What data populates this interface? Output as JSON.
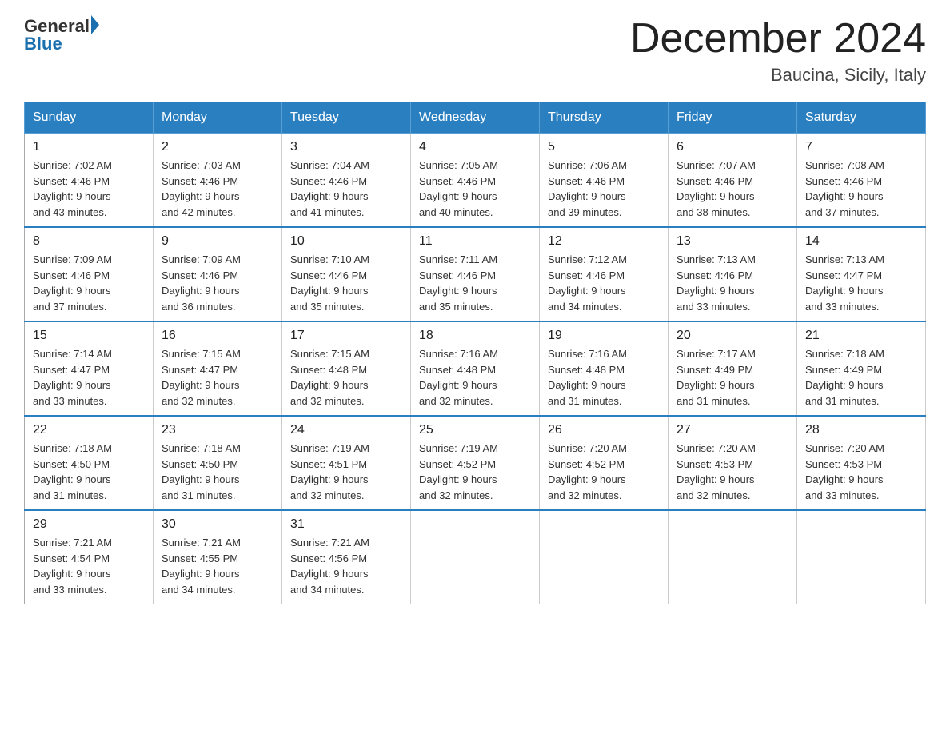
{
  "header": {
    "logo": {
      "general": "General",
      "arrow": "▶",
      "blue": "Blue"
    },
    "title": "December 2024",
    "location": "Baucina, Sicily, Italy"
  },
  "days_of_week": [
    "Sunday",
    "Monday",
    "Tuesday",
    "Wednesday",
    "Thursday",
    "Friday",
    "Saturday"
  ],
  "weeks": [
    [
      {
        "day": "1",
        "sunrise": "7:02 AM",
        "sunset": "4:46 PM",
        "daylight": "9 hours and 43 minutes."
      },
      {
        "day": "2",
        "sunrise": "7:03 AM",
        "sunset": "4:46 PM",
        "daylight": "9 hours and 42 minutes."
      },
      {
        "day": "3",
        "sunrise": "7:04 AM",
        "sunset": "4:46 PM",
        "daylight": "9 hours and 41 minutes."
      },
      {
        "day": "4",
        "sunrise": "7:05 AM",
        "sunset": "4:46 PM",
        "daylight": "9 hours and 40 minutes."
      },
      {
        "day": "5",
        "sunrise": "7:06 AM",
        "sunset": "4:46 PM",
        "daylight": "9 hours and 39 minutes."
      },
      {
        "day": "6",
        "sunrise": "7:07 AM",
        "sunset": "4:46 PM",
        "daylight": "9 hours and 38 minutes."
      },
      {
        "day": "7",
        "sunrise": "7:08 AM",
        "sunset": "4:46 PM",
        "daylight": "9 hours and 37 minutes."
      }
    ],
    [
      {
        "day": "8",
        "sunrise": "7:09 AM",
        "sunset": "4:46 PM",
        "daylight": "9 hours and 37 minutes."
      },
      {
        "day": "9",
        "sunrise": "7:09 AM",
        "sunset": "4:46 PM",
        "daylight": "9 hours and 36 minutes."
      },
      {
        "day": "10",
        "sunrise": "7:10 AM",
        "sunset": "4:46 PM",
        "daylight": "9 hours and 35 minutes."
      },
      {
        "day": "11",
        "sunrise": "7:11 AM",
        "sunset": "4:46 PM",
        "daylight": "9 hours and 35 minutes."
      },
      {
        "day": "12",
        "sunrise": "7:12 AM",
        "sunset": "4:46 PM",
        "daylight": "9 hours and 34 minutes."
      },
      {
        "day": "13",
        "sunrise": "7:13 AM",
        "sunset": "4:46 PM",
        "daylight": "9 hours and 33 minutes."
      },
      {
        "day": "14",
        "sunrise": "7:13 AM",
        "sunset": "4:47 PM",
        "daylight": "9 hours and 33 minutes."
      }
    ],
    [
      {
        "day": "15",
        "sunrise": "7:14 AM",
        "sunset": "4:47 PM",
        "daylight": "9 hours and 33 minutes."
      },
      {
        "day": "16",
        "sunrise": "7:15 AM",
        "sunset": "4:47 PM",
        "daylight": "9 hours and 32 minutes."
      },
      {
        "day": "17",
        "sunrise": "7:15 AM",
        "sunset": "4:48 PM",
        "daylight": "9 hours and 32 minutes."
      },
      {
        "day": "18",
        "sunrise": "7:16 AM",
        "sunset": "4:48 PM",
        "daylight": "9 hours and 32 minutes."
      },
      {
        "day": "19",
        "sunrise": "7:16 AM",
        "sunset": "4:48 PM",
        "daylight": "9 hours and 31 minutes."
      },
      {
        "day": "20",
        "sunrise": "7:17 AM",
        "sunset": "4:49 PM",
        "daylight": "9 hours and 31 minutes."
      },
      {
        "day": "21",
        "sunrise": "7:18 AM",
        "sunset": "4:49 PM",
        "daylight": "9 hours and 31 minutes."
      }
    ],
    [
      {
        "day": "22",
        "sunrise": "7:18 AM",
        "sunset": "4:50 PM",
        "daylight": "9 hours and 31 minutes."
      },
      {
        "day": "23",
        "sunrise": "7:18 AM",
        "sunset": "4:50 PM",
        "daylight": "9 hours and 31 minutes."
      },
      {
        "day": "24",
        "sunrise": "7:19 AM",
        "sunset": "4:51 PM",
        "daylight": "9 hours and 32 minutes."
      },
      {
        "day": "25",
        "sunrise": "7:19 AM",
        "sunset": "4:52 PM",
        "daylight": "9 hours and 32 minutes."
      },
      {
        "day": "26",
        "sunrise": "7:20 AM",
        "sunset": "4:52 PM",
        "daylight": "9 hours and 32 minutes."
      },
      {
        "day": "27",
        "sunrise": "7:20 AM",
        "sunset": "4:53 PM",
        "daylight": "9 hours and 32 minutes."
      },
      {
        "day": "28",
        "sunrise": "7:20 AM",
        "sunset": "4:53 PM",
        "daylight": "9 hours and 33 minutes."
      }
    ],
    [
      {
        "day": "29",
        "sunrise": "7:21 AM",
        "sunset": "4:54 PM",
        "daylight": "9 hours and 33 minutes."
      },
      {
        "day": "30",
        "sunrise": "7:21 AM",
        "sunset": "4:55 PM",
        "daylight": "9 hours and 34 minutes."
      },
      {
        "day": "31",
        "sunrise": "7:21 AM",
        "sunset": "4:56 PM",
        "daylight": "9 hours and 34 minutes."
      },
      null,
      null,
      null,
      null
    ]
  ],
  "labels": {
    "sunrise": "Sunrise:",
    "sunset": "Sunset:",
    "daylight": "Daylight:"
  }
}
